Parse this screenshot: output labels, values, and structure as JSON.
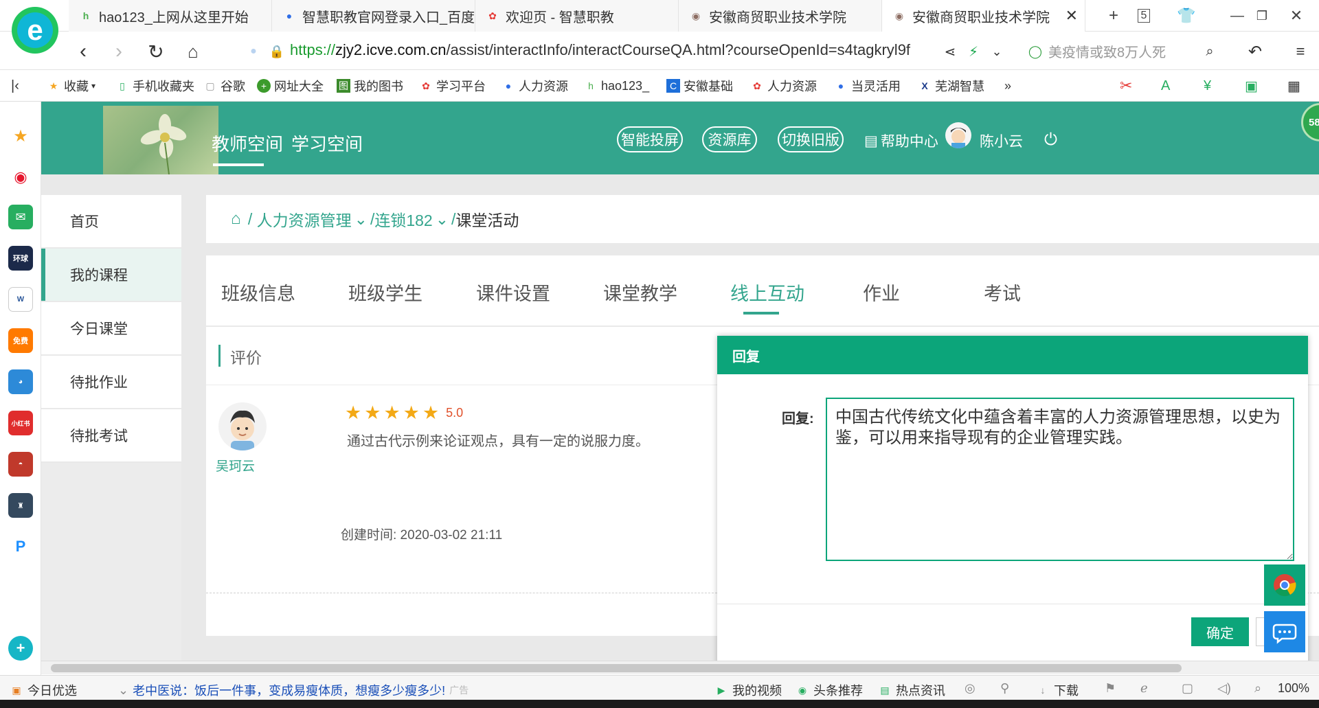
{
  "browser": {
    "tabs": [
      {
        "title": "hao123_上网从这里开始",
        "icon": "hao123-icon",
        "active": false
      },
      {
        "title": "智慧职教官网登录入口_百度",
        "icon": "baidu-paw-icon",
        "active": false
      },
      {
        "title": "欢迎页 - 智慧职教",
        "icon": "icve-flower-icon",
        "active": false
      },
      {
        "title": "安徽商贸职业技术学院",
        "icon": "school-logo-icon",
        "active": false
      },
      {
        "title": "安徽商贸职业技术学院",
        "icon": "school-logo-icon",
        "active": true
      }
    ],
    "tab_count": "5",
    "url": {
      "scheme": "https://",
      "host": "zjy2.icve.com.cn",
      "path": "/assist/interactInfo/interactCourseQA.html?courseOpenId=s4tagkryl9f"
    },
    "search_placeholder": "美疫情或致8万人死",
    "bookmarks": [
      {
        "label": "收藏",
        "icon": "star-icon"
      },
      {
        "label": "手机收藏夹",
        "icon": "phone-icon"
      },
      {
        "label": "谷歌",
        "icon": "page-icon"
      },
      {
        "label": "网址大全",
        "icon": "plus-globe-icon"
      },
      {
        "label": "我的图书",
        "icon": "library-icon"
      },
      {
        "label": "学习平台",
        "icon": "flower-icon"
      },
      {
        "label": "人力资源",
        "icon": "baidu-paw-icon"
      },
      {
        "label": "hao123_",
        "icon": "hao123-icon"
      },
      {
        "label": "安徽基础",
        "icon": "c-logo-icon"
      },
      {
        "label": "人力资源",
        "icon": "flower-icon"
      },
      {
        "label": "当灵活用",
        "icon": "baidu-paw-icon"
      },
      {
        "label": "芜湖智慧",
        "icon": "x-logo-icon"
      }
    ],
    "bookmarks_more": "»",
    "sidebar_icons": [
      {
        "name": "favorites-star-icon",
        "color": "#f5a623",
        "label": "★"
      },
      {
        "name": "weibo-icon",
        "color": "#e6162d",
        "label": "微"
      },
      {
        "name": "mail-icon",
        "color": "#27ae60",
        "label": "✉"
      },
      {
        "name": "huanqiu-school-icon",
        "color": "#1c2a4a",
        "label": "环球"
      },
      {
        "name": "word-doc-icon",
        "color": "#2b579a",
        "label": "W"
      },
      {
        "name": "free-novel-icon",
        "color": "#ff7a00",
        "label": "免费"
      },
      {
        "name": "game-angry-icon",
        "color": "#2d8ad8",
        "label": "游"
      },
      {
        "name": "xiaohongshu-icon",
        "color": "#e02d2d",
        "label": "小红书"
      },
      {
        "name": "game-hero-icon",
        "color": "#c0392b",
        "label": "游"
      },
      {
        "name": "game-castle-icon",
        "color": "#34495e",
        "label": "游"
      },
      {
        "name": "p-app-icon",
        "color": "#1e90ff",
        "label": "P"
      }
    ]
  },
  "site": {
    "nav": [
      "教师空间",
      "学习空间"
    ],
    "header_buttons": [
      "智能投屏",
      "资源库",
      "切换旧版"
    ],
    "help": "帮助中心",
    "user_name": "陈小云"
  },
  "menu": [
    "首页",
    "我的课程",
    "今日课堂",
    "待批作业",
    "待批考试"
  ],
  "breadcrumb": {
    "course": "人力资源管理",
    "class": "连锁182",
    "current": "课堂活动"
  },
  "course_tabs": [
    "班级信息",
    "班级学生",
    "课件设置",
    "课堂教学",
    "线上互动",
    "作业",
    "考试"
  ],
  "evaluation": {
    "heading": "评价",
    "student": "吴珂云",
    "rating": 5,
    "score": "5.0",
    "comment": "通过古代示例来论证观点，具有一定的说服力度。",
    "created": "创建时间: 2020-03-02 21:11"
  },
  "reply_modal": {
    "title": "回复",
    "label": "回复:",
    "text": "中国古代传统文化中蕴含着丰富的人力资源管理思想，以史为鉴，可以用来指导现有的企业管理实践。",
    "confirm": "确定"
  },
  "badge_count": "58",
  "statusbar": {
    "left": "今日优选",
    "news": "老中医说：饭后一件事，变成易瘦体质，想瘦多少瘦多少!",
    "news_ad": "广告",
    "items": [
      "我的视频",
      "头条推荐",
      "热点资讯"
    ],
    "download": "下载",
    "zoom": "100%"
  },
  "colors": {
    "site_green": "#33a58d",
    "modal_green": "#0ca57a",
    "star": "#f3a916",
    "score": "#e0502a"
  }
}
